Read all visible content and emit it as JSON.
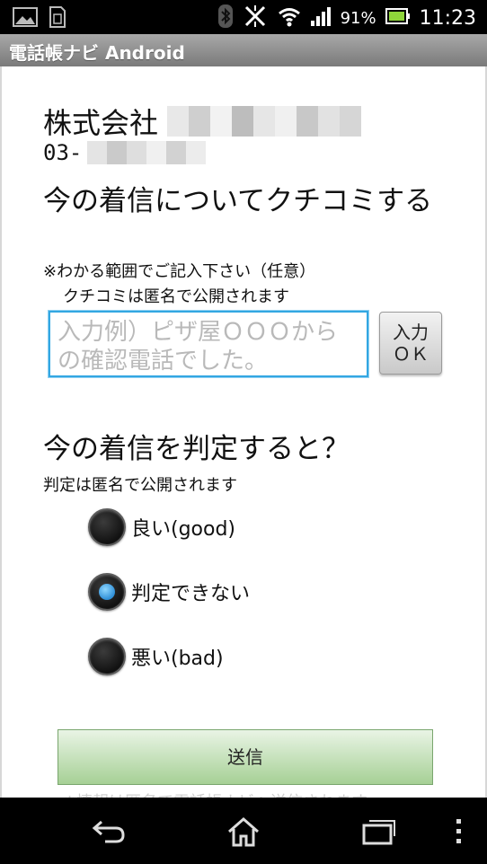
{
  "status_bar": {
    "battery_percent": "91%",
    "time": "11:23",
    "icons": [
      "gallery-icon",
      "sim-icon",
      "bluetooth-icon",
      "nfc-icon",
      "wifi-icon",
      "signal-icon",
      "battery-icon"
    ]
  },
  "app": {
    "title": "電話帳ナビ Android"
  },
  "company": {
    "name_prefix": "株式会社",
    "phone_prefix": "03-"
  },
  "review": {
    "heading": "今の着信についてクチコミする",
    "note_line1": "※わかる範囲でご記入下さい（任意）",
    "note_line2": "クチコミは匿名で公開されます",
    "input_placeholder": "入力例）ピザ屋ＯＯＯからの確認電話でした。",
    "ok_button_line1": "入力",
    "ok_button_line2": "ＯＫ"
  },
  "judgement": {
    "heading": "今の着信を判定すると？",
    "note": "判定は匿名で公開されます",
    "options": [
      {
        "label": "良い(good)",
        "checked": false
      },
      {
        "label": "判定できない",
        "checked": true
      },
      {
        "label": "悪い(bad)",
        "checked": false
      }
    ]
  },
  "actions": {
    "send_label": "送信",
    "footer_note": "※情報は匿名で電話帳ナビへ送信されます"
  },
  "colors": {
    "input_border": "#33a7e2",
    "send_button": "#a6d095",
    "radio_selected": "#2f8fd7",
    "title_bar": "#8a8a8a"
  }
}
